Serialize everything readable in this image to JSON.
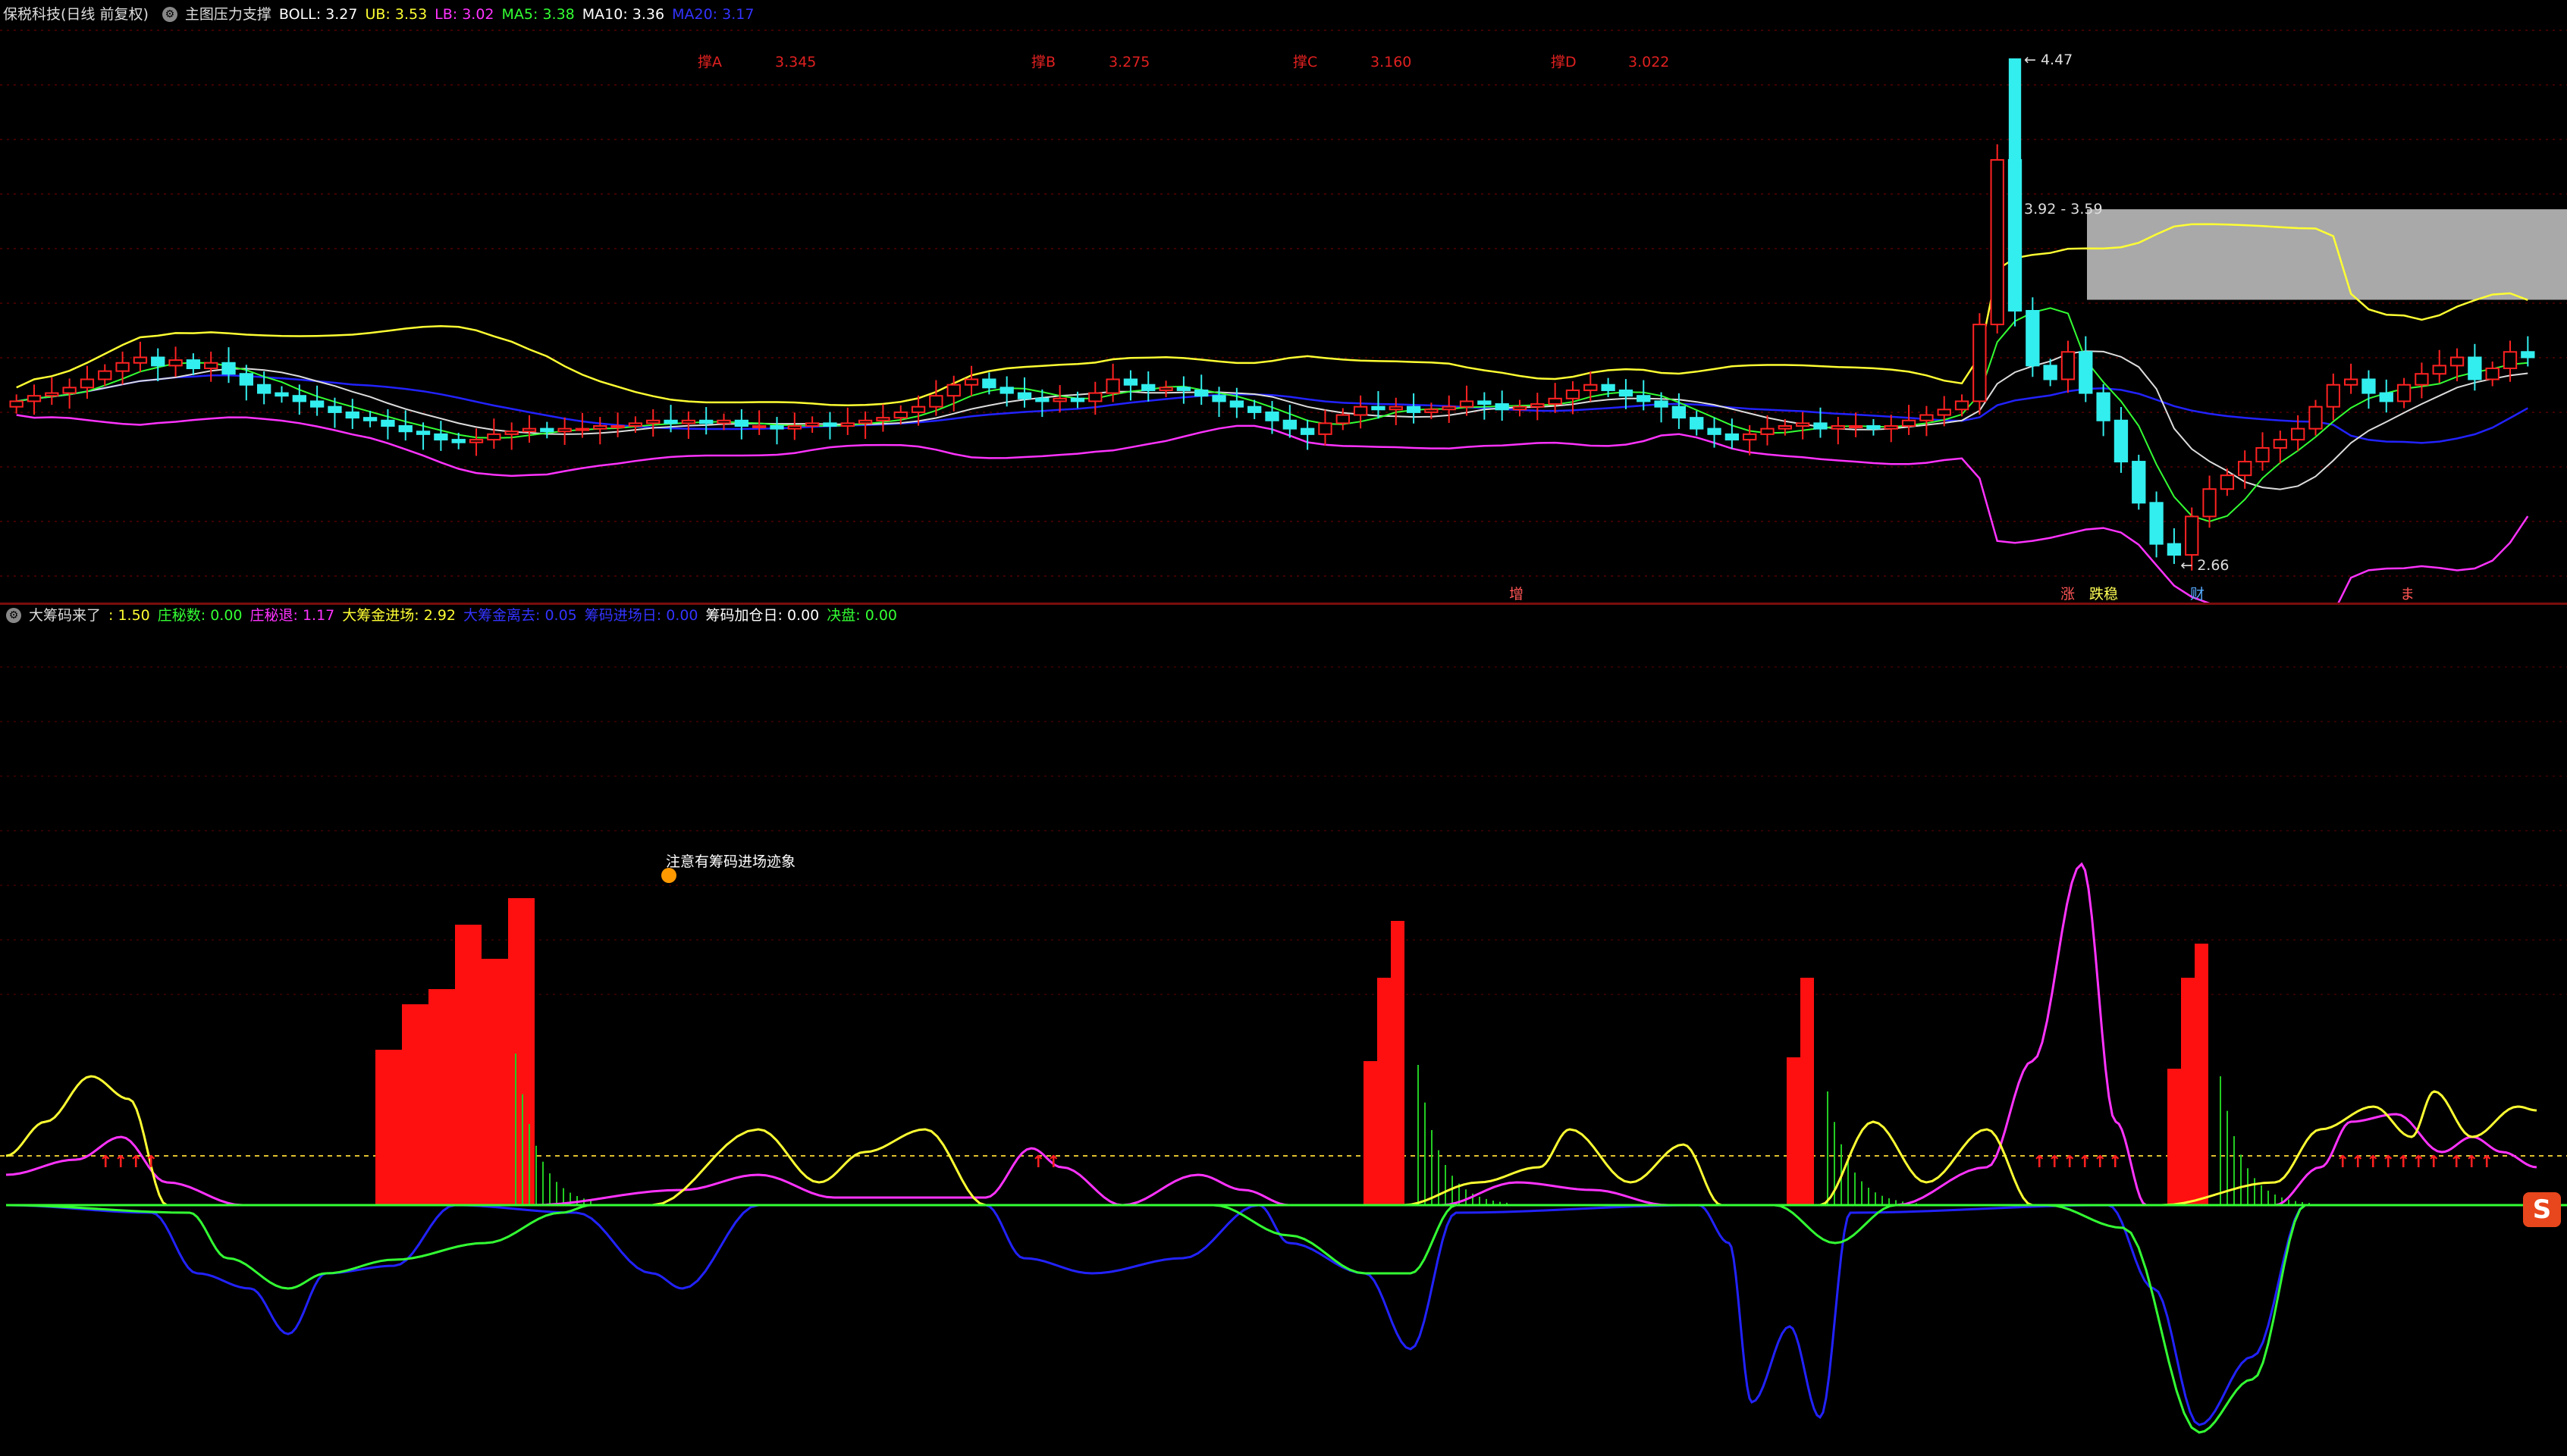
{
  "top_header": {
    "title": "保税科技(日线 前复权)",
    "indicator": "主图压力支撑",
    "items": [
      {
        "label": "BOLL:",
        "value": "3.27",
        "color": "#ffffff"
      },
      {
        "label": "UB:",
        "value": "3.53",
        "color": "#ffff33"
      },
      {
        "label": "LB:",
        "value": "3.02",
        "color": "#ff33ff"
      },
      {
        "label": "MA5:",
        "value": "3.38",
        "color": "#33ff33"
      },
      {
        "label": "MA10:",
        "value": "3.36",
        "color": "#ffffff"
      },
      {
        "label": "MA20:",
        "value": "3.17",
        "color": "#3333ff"
      }
    ]
  },
  "levels": [
    {
      "name": "撑A",
      "value": "3.345"
    },
    {
      "name": "撑B",
      "value": "3.275"
    },
    {
      "name": "撑C",
      "value": "3.160"
    },
    {
      "name": "撑D",
      "value": "3.022"
    }
  ],
  "price_labels": {
    "high": "4.47",
    "range": "3.92 - 3.59",
    "low": "2.66"
  },
  "markers": [
    {
      "text": "增",
      "color": "#ff5555"
    },
    {
      "text": "涨",
      "color": "#ff5555"
    },
    {
      "text": "跌稳",
      "color": "#ffff55"
    },
    {
      "text": "财",
      "color": "#55aaff"
    },
    {
      "text": "ま",
      "color": "#ff5555"
    }
  ],
  "bottom_header": {
    "indicator": "大筹码来了",
    "items": [
      {
        "label": ":",
        "value": "1.50",
        "color": "#ffff33"
      },
      {
        "label": "庄秘数:",
        "value": "0.00",
        "color": "#33ff33"
      },
      {
        "label": "庄秘退:",
        "value": "1.17",
        "color": "#ff33ff"
      },
      {
        "label": "大筹金进场:",
        "value": "2.92",
        "color": "#ffff33"
      },
      {
        "label": "大筹金离去:",
        "value": "0.05",
        "color": "#3333ff"
      },
      {
        "label": "筹码进场日:",
        "value": "0.00",
        "color": "#3333ff"
      },
      {
        "label": "筹码加仓日:",
        "value": "0.00",
        "color": "#ffffff"
      },
      {
        "label": "决盘:",
        "value": "0.00",
        "color": "#33ff33"
      }
    ]
  },
  "annotation": "注意有筹码进场迹象",
  "colors": {
    "up": "#ff2222",
    "down": "#33eeee",
    "ub": "#ffff33",
    "lb": "#ff33ff",
    "ma5": "#33ff33",
    "ma10": "#dddddd",
    "ma20": "#2222ff"
  },
  "chart_data": [
    {
      "type": "candlestick",
      "title": "保税科技(日线 前复权)",
      "ylim": [
        2.5,
        4.6
      ],
      "annotations": {
        "high": 4.47,
        "low": 2.66,
        "box": [
          3.59,
          3.92
        ]
      },
      "closes": [
        3.22,
        3.24,
        3.25,
        3.27,
        3.3,
        3.33,
        3.36,
        3.38,
        3.35,
        3.37,
        3.34,
        3.36,
        3.32,
        3.28,
        3.25,
        3.24,
        3.22,
        3.2,
        3.18,
        3.16,
        3.15,
        3.13,
        3.11,
        3.1,
        3.08,
        3.07,
        3.08,
        3.1,
        3.11,
        3.12,
        3.11,
        3.12,
        3.12,
        3.13,
        3.13,
        3.14,
        3.15,
        3.14,
        3.15,
        3.14,
        3.15,
        3.13,
        3.13,
        3.12,
        3.13,
        3.14,
        3.13,
        3.14,
        3.15,
        3.16,
        3.18,
        3.2,
        3.24,
        3.28,
        3.3,
        3.27,
        3.25,
        3.23,
        3.22,
        3.23,
        3.22,
        3.25,
        3.3,
        3.28,
        3.26,
        3.27,
        3.26,
        3.24,
        3.22,
        3.2,
        3.18,
        3.15,
        3.12,
        3.1,
        3.14,
        3.17,
        3.2,
        3.19,
        3.2,
        3.18,
        3.19,
        3.2,
        3.22,
        3.21,
        3.19,
        3.2,
        3.21,
        3.23,
        3.26,
        3.28,
        3.26,
        3.24,
        3.22,
        3.2,
        3.16,
        3.12,
        3.1,
        3.08,
        3.1,
        3.12,
        3.13,
        3.14,
        3.12,
        3.13,
        3.13,
        3.12,
        3.13,
        3.15,
        3.17,
        3.19,
        3.22,
        3.5,
        4.1,
        3.55,
        3.35,
        3.3,
        3.4,
        3.25,
        3.15,
        3.0,
        2.85,
        2.7,
        2.66,
        2.8,
        2.9,
        2.95,
        3.0,
        3.05,
        3.08,
        3.12,
        3.2,
        3.28,
        3.3,
        3.25,
        3.22,
        3.28,
        3.32,
        3.35,
        3.38,
        3.3,
        3.34,
        3.4,
        3.38
      ]
    },
    {
      "type": "line",
      "title": "大筹码来了",
      "series": [
        "1.50",
        "庄秘数",
        "庄秘退",
        "大筹金进场",
        "大筹金离去"
      ]
    }
  ]
}
